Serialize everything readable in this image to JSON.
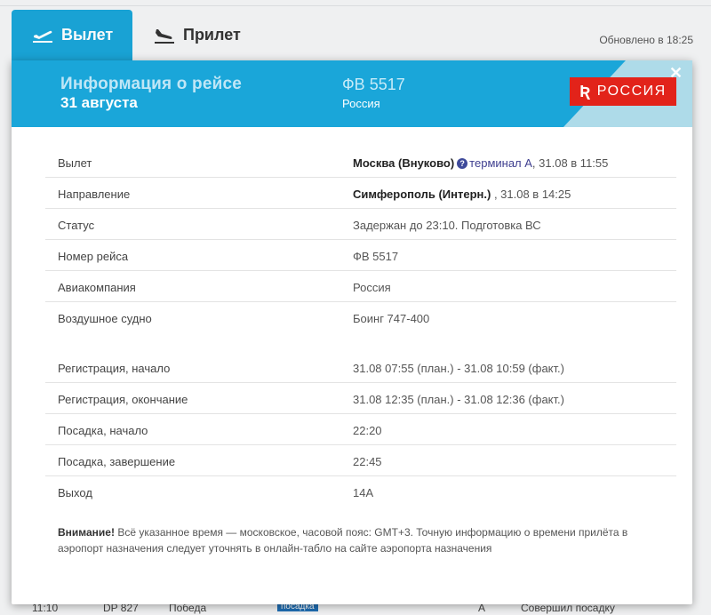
{
  "background": {
    "tabs": [
      {
        "label": "Вылет",
        "active": true
      },
      {
        "label": "Прилет",
        "active": false
      }
    ],
    "updated": "Обновлено в 18:25",
    "row": {
      "time": "11:10",
      "flight": "DP 827",
      "airline": "Победа",
      "badge": "посадка",
      "gate": "А",
      "status": "Совершил посадку"
    }
  },
  "modal": {
    "title": "Информация о рейсе",
    "date": "31 августа",
    "flight_number": "ФВ 5517",
    "airline_name": "Россия",
    "logo_text": "РОССИЯ",
    "close_label": "✕",
    "rows": [
      {
        "label": "Вылет",
        "value_main": "Москва (Внуково)",
        "value_link": "терминал А",
        "value_rest": ", 31.08 в 11:55"
      },
      {
        "label": "Направление",
        "value_main": "Симферополь (Интерн.)",
        "value_rest": " , 31.08 в 14:25"
      },
      {
        "label": "Статус",
        "value": "Задержан до 23:10. Подготовка ВС"
      },
      {
        "label": "Номер рейса",
        "value": "ФВ 5517"
      },
      {
        "label": "Авиакомпания",
        "value": "Россия"
      },
      {
        "label": "Воздушное судно",
        "value": "Боинг 747-400"
      },
      {
        "label": "Регистрация, начало",
        "value": "31.08 07:55 (план.) - 31.08 10:59 (факт.)"
      },
      {
        "label": "Регистрация, окончание",
        "value": "31.08 12:35 (план.) - 31.08 12:36 (факт.)"
      },
      {
        "label": "Посадка, начало",
        "value": "22:20"
      },
      {
        "label": "Посадка, завершение",
        "value": "22:45"
      },
      {
        "label": "Выход",
        "value": "14А"
      }
    ],
    "notice_bold": "Внимание!",
    "notice_text": " Всё указанное время — московское, часовой пояс: GMT+3. Точную информацию о времени прилёта в аэропорт назначения следует уточнять в онлайн-табло на сайте аэропорта назначения"
  },
  "colors": {
    "accent": "#1aa6d9",
    "logo_red": "#e2231a",
    "link": "#3e3e8f"
  },
  "icons": {
    "departure": "plane-departure-icon",
    "arrival": "plane-arrival-icon",
    "help": "question-icon",
    "close": "close-icon"
  }
}
